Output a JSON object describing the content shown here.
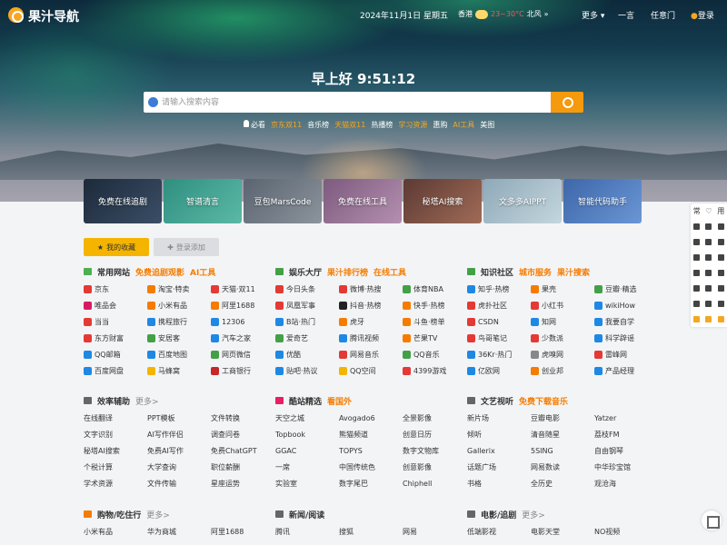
{
  "header": {
    "logo_text": "果汁导航",
    "date": "2024年11月1日 星期五",
    "weather": {
      "city": "香港",
      "temp": "23~30°C",
      "wind": "北风",
      "arrow": "»"
    },
    "nav": {
      "more": "更多",
      "yiyan": "一言",
      "rendian": "任意门",
      "login": "登录"
    }
  },
  "greeting": "早上好  9:51:12",
  "search": {
    "placeholder": "请输入搜索内容"
  },
  "hot_links": [
    "必看",
    "京东双11",
    "音乐榜",
    "天猫双11",
    "热播榜",
    "学习资源",
    "惠购",
    "AI工具",
    "美图"
  ],
  "feature_cards": [
    "免费在线追剧",
    "智谱清言",
    "豆包MarsCode",
    "免费在线工具",
    "秘塔AI搜索",
    "文多多AIPPT",
    "智能代码助手"
  ],
  "tabs": {
    "favorites": "我的收藏",
    "login_add": "登录添加"
  },
  "sections": {
    "common": {
      "title": "常用网站",
      "tag1": "免费追剧观影",
      "tag2": "AI工具",
      "items": [
        "京东",
        "淘宝·特卖",
        "天猫·双11",
        "唯品会",
        "小米有品",
        "阿里1688",
        "当当",
        "携程旅行",
        "12306",
        "东方财富",
        "安居客",
        "汽车之家",
        "QQ邮箱",
        "百度地图",
        "网页微信",
        "百度网盘",
        "马蜂窝",
        "工商银行"
      ]
    },
    "ent": {
      "title": "娱乐大厅",
      "tag1": "果汁排行榜",
      "tag2": "在线工具",
      "items": [
        "今日头条",
        "微博·热搜",
        "体育NBA",
        "凤凰军事",
        "抖音·热榜",
        "快手·热榜",
        "B站·热门",
        "虎牙",
        "斗鱼·榜单",
        "爱奇艺",
        "腾讯视频",
        "芒果TV",
        "优酷",
        "网易音乐",
        "QQ音乐",
        "贴吧·热议",
        "QQ空间",
        "4399游戏"
      ]
    },
    "know": {
      "title": "知识社区",
      "tag1": "城市服务",
      "tag2": "果汁搜索",
      "items": [
        "知乎·热榜",
        "果壳",
        "豆瓣·精选",
        "虎扑社区",
        "小红书",
        "wikiHow",
        "CSDN",
        "知网",
        "我要自学",
        "鸟哥笔记",
        "少数派",
        "科学辟谣",
        "36Kr·热门",
        "虎嗅网",
        "雷峰网",
        "亿欧网",
        "创业邦",
        "产品经理"
      ]
    },
    "eff": {
      "title": "效率辅助",
      "more": "更多>",
      "items": [
        "在线翻译",
        "PPT模板",
        "文件转换",
        "文字识别",
        "AI写作伴侣",
        "调查问卷",
        "秘塔AI搜索",
        "免费AI写作",
        "免费ChatGPT",
        "个税计算",
        "大学查询",
        "职位薪酬",
        "学术资源",
        "文件传输",
        "星座运势"
      ]
    },
    "cool": {
      "title": "酷站精选",
      "tag1": "看国外",
      "items": [
        "天空之城",
        "Avogado6",
        "全景影像",
        "Topbook",
        "熊猫频道",
        "创意日历",
        "GGAC",
        "TOPYS",
        "数字文物库",
        "一席",
        "中国传统色",
        "创意影像",
        "实验室",
        "数字尾巴",
        "Chiphell"
      ]
    },
    "art": {
      "title": "文艺视听",
      "tag1": "免费下载音乐",
      "items": [
        "新片场",
        "豆瓣电影",
        "Yatzer",
        "倾听",
        "清音随星",
        "荔枝FM",
        "Gallerix",
        "5SING",
        "自由钢琴",
        "话题广场",
        "网易数读",
        "中华珍宝馆",
        "书格",
        "全历史",
        "观沧海"
      ]
    },
    "shop": {
      "title": "购物/吃住行",
      "more": "更多>",
      "items": [
        "小米有品",
        "华为商城",
        "阿里1688"
      ]
    },
    "news": {
      "title": "新闻/阅读",
      "items": [
        "腾讯",
        "搜狐",
        "网易"
      ]
    },
    "film": {
      "title": "电影/追剧",
      "more": "更多>",
      "items": [
        "低端影视",
        "电影天堂",
        "NO视频"
      ]
    }
  },
  "side_toolbar": [
    "常",
    "♡",
    "用"
  ],
  "colors": {
    "accent": "#f59a0c",
    "tag": "#f57c00"
  }
}
